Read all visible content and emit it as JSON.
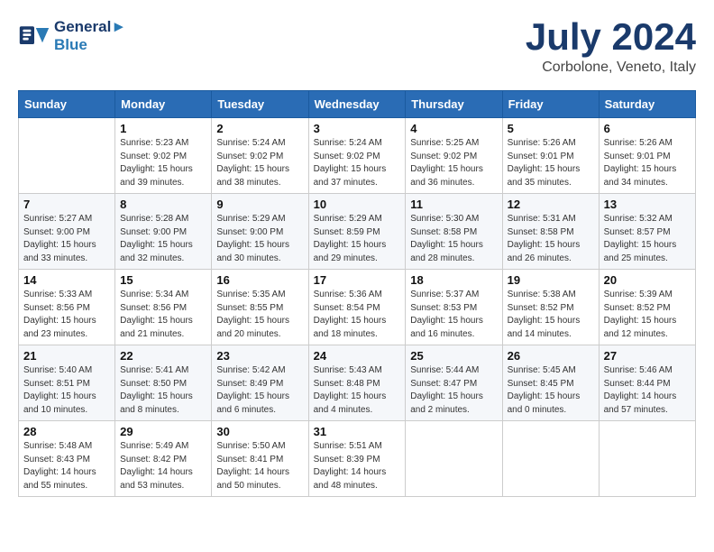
{
  "header": {
    "logo_line1": "General",
    "logo_line2": "Blue",
    "month": "July 2024",
    "location": "Corbolone, Veneto, Italy"
  },
  "weekdays": [
    "Sunday",
    "Monday",
    "Tuesday",
    "Wednesday",
    "Thursday",
    "Friday",
    "Saturday"
  ],
  "weeks": [
    [
      {
        "day": null,
        "sunrise": null,
        "sunset": null,
        "daylight": null
      },
      {
        "day": "1",
        "sunrise": "Sunrise: 5:23 AM",
        "sunset": "Sunset: 9:02 PM",
        "daylight": "Daylight: 15 hours and 39 minutes."
      },
      {
        "day": "2",
        "sunrise": "Sunrise: 5:24 AM",
        "sunset": "Sunset: 9:02 PM",
        "daylight": "Daylight: 15 hours and 38 minutes."
      },
      {
        "day": "3",
        "sunrise": "Sunrise: 5:24 AM",
        "sunset": "Sunset: 9:02 PM",
        "daylight": "Daylight: 15 hours and 37 minutes."
      },
      {
        "day": "4",
        "sunrise": "Sunrise: 5:25 AM",
        "sunset": "Sunset: 9:02 PM",
        "daylight": "Daylight: 15 hours and 36 minutes."
      },
      {
        "day": "5",
        "sunrise": "Sunrise: 5:26 AM",
        "sunset": "Sunset: 9:01 PM",
        "daylight": "Daylight: 15 hours and 35 minutes."
      },
      {
        "day": "6",
        "sunrise": "Sunrise: 5:26 AM",
        "sunset": "Sunset: 9:01 PM",
        "daylight": "Daylight: 15 hours and 34 minutes."
      }
    ],
    [
      {
        "day": "7",
        "sunrise": "Sunrise: 5:27 AM",
        "sunset": "Sunset: 9:00 PM",
        "daylight": "Daylight: 15 hours and 33 minutes."
      },
      {
        "day": "8",
        "sunrise": "Sunrise: 5:28 AM",
        "sunset": "Sunset: 9:00 PM",
        "daylight": "Daylight: 15 hours and 32 minutes."
      },
      {
        "day": "9",
        "sunrise": "Sunrise: 5:29 AM",
        "sunset": "Sunset: 9:00 PM",
        "daylight": "Daylight: 15 hours and 30 minutes."
      },
      {
        "day": "10",
        "sunrise": "Sunrise: 5:29 AM",
        "sunset": "Sunset: 8:59 PM",
        "daylight": "Daylight: 15 hours and 29 minutes."
      },
      {
        "day": "11",
        "sunrise": "Sunrise: 5:30 AM",
        "sunset": "Sunset: 8:58 PM",
        "daylight": "Daylight: 15 hours and 28 minutes."
      },
      {
        "day": "12",
        "sunrise": "Sunrise: 5:31 AM",
        "sunset": "Sunset: 8:58 PM",
        "daylight": "Daylight: 15 hours and 26 minutes."
      },
      {
        "day": "13",
        "sunrise": "Sunrise: 5:32 AM",
        "sunset": "Sunset: 8:57 PM",
        "daylight": "Daylight: 15 hours and 25 minutes."
      }
    ],
    [
      {
        "day": "14",
        "sunrise": "Sunrise: 5:33 AM",
        "sunset": "Sunset: 8:56 PM",
        "daylight": "Daylight: 15 hours and 23 minutes."
      },
      {
        "day": "15",
        "sunrise": "Sunrise: 5:34 AM",
        "sunset": "Sunset: 8:56 PM",
        "daylight": "Daylight: 15 hours and 21 minutes."
      },
      {
        "day": "16",
        "sunrise": "Sunrise: 5:35 AM",
        "sunset": "Sunset: 8:55 PM",
        "daylight": "Daylight: 15 hours and 20 minutes."
      },
      {
        "day": "17",
        "sunrise": "Sunrise: 5:36 AM",
        "sunset": "Sunset: 8:54 PM",
        "daylight": "Daylight: 15 hours and 18 minutes."
      },
      {
        "day": "18",
        "sunrise": "Sunrise: 5:37 AM",
        "sunset": "Sunset: 8:53 PM",
        "daylight": "Daylight: 15 hours and 16 minutes."
      },
      {
        "day": "19",
        "sunrise": "Sunrise: 5:38 AM",
        "sunset": "Sunset: 8:52 PM",
        "daylight": "Daylight: 15 hours and 14 minutes."
      },
      {
        "day": "20",
        "sunrise": "Sunrise: 5:39 AM",
        "sunset": "Sunset: 8:52 PM",
        "daylight": "Daylight: 15 hours and 12 minutes."
      }
    ],
    [
      {
        "day": "21",
        "sunrise": "Sunrise: 5:40 AM",
        "sunset": "Sunset: 8:51 PM",
        "daylight": "Daylight: 15 hours and 10 minutes."
      },
      {
        "day": "22",
        "sunrise": "Sunrise: 5:41 AM",
        "sunset": "Sunset: 8:50 PM",
        "daylight": "Daylight: 15 hours and 8 minutes."
      },
      {
        "day": "23",
        "sunrise": "Sunrise: 5:42 AM",
        "sunset": "Sunset: 8:49 PM",
        "daylight": "Daylight: 15 hours and 6 minutes."
      },
      {
        "day": "24",
        "sunrise": "Sunrise: 5:43 AM",
        "sunset": "Sunset: 8:48 PM",
        "daylight": "Daylight: 15 hours and 4 minutes."
      },
      {
        "day": "25",
        "sunrise": "Sunrise: 5:44 AM",
        "sunset": "Sunset: 8:47 PM",
        "daylight": "Daylight: 15 hours and 2 minutes."
      },
      {
        "day": "26",
        "sunrise": "Sunrise: 5:45 AM",
        "sunset": "Sunset: 8:45 PM",
        "daylight": "Daylight: 15 hours and 0 minutes."
      },
      {
        "day": "27",
        "sunrise": "Sunrise: 5:46 AM",
        "sunset": "Sunset: 8:44 PM",
        "daylight": "Daylight: 14 hours and 57 minutes."
      }
    ],
    [
      {
        "day": "28",
        "sunrise": "Sunrise: 5:48 AM",
        "sunset": "Sunset: 8:43 PM",
        "daylight": "Daylight: 14 hours and 55 minutes."
      },
      {
        "day": "29",
        "sunrise": "Sunrise: 5:49 AM",
        "sunset": "Sunset: 8:42 PM",
        "daylight": "Daylight: 14 hours and 53 minutes."
      },
      {
        "day": "30",
        "sunrise": "Sunrise: 5:50 AM",
        "sunset": "Sunset: 8:41 PM",
        "daylight": "Daylight: 14 hours and 50 minutes."
      },
      {
        "day": "31",
        "sunrise": "Sunrise: 5:51 AM",
        "sunset": "Sunset: 8:39 PM",
        "daylight": "Daylight: 14 hours and 48 minutes."
      },
      {
        "day": null,
        "sunrise": null,
        "sunset": null,
        "daylight": null
      },
      {
        "day": null,
        "sunrise": null,
        "sunset": null,
        "daylight": null
      },
      {
        "day": null,
        "sunrise": null,
        "sunset": null,
        "daylight": null
      }
    ]
  ]
}
